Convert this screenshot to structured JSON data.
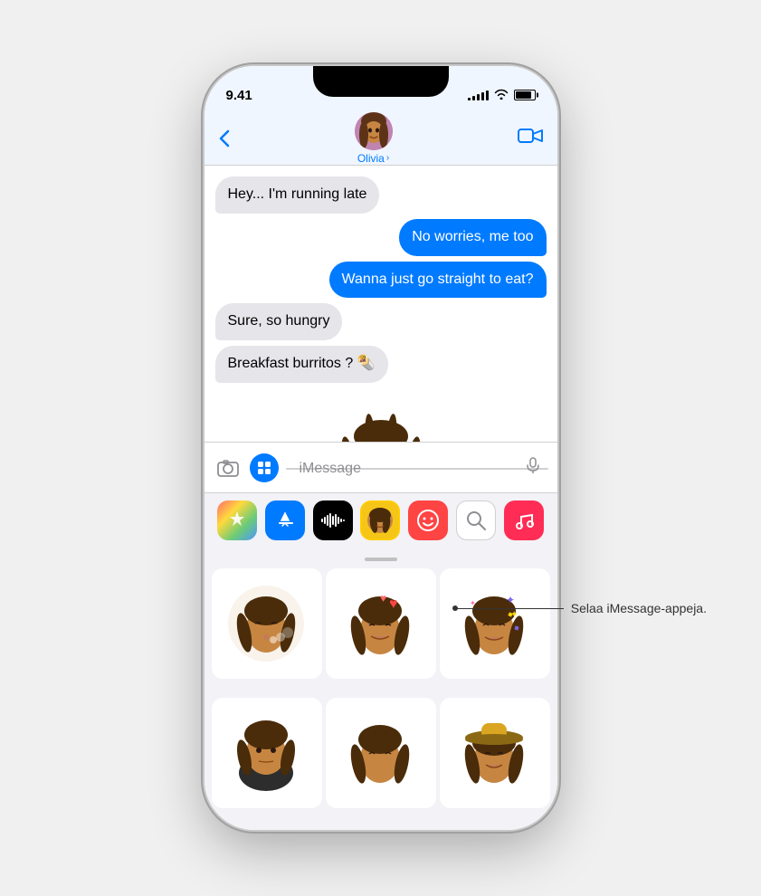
{
  "status_bar": {
    "time": "9.41",
    "signal_bars": [
      3,
      5,
      7,
      9,
      11
    ],
    "wifi": "wifi",
    "battery": 85
  },
  "nav": {
    "back_label": "‹",
    "contact_name": "Olivia",
    "chevron": "›",
    "video_icon": "video"
  },
  "messages": [
    {
      "id": 1,
      "type": "incoming",
      "text": "Hey... I'm running late"
    },
    {
      "id": 2,
      "type": "outgoing",
      "text": "No worries, me too"
    },
    {
      "id": 3,
      "type": "outgoing",
      "text": "Wanna just go straight to eat?"
    },
    {
      "id": 4,
      "type": "incoming",
      "text": "Sure, so hungry"
    },
    {
      "id": 5,
      "type": "incoming",
      "text": "Breakfast burritos ? 🌯"
    }
  ],
  "sticker_area": {
    "drag_handle": true,
    "stickers": [
      {
        "id": 1,
        "emoji": "😮‍💨",
        "label": "memoji-sneeze"
      },
      {
        "id": 2,
        "emoji": "🥰",
        "label": "memoji-love"
      },
      {
        "id": 3,
        "emoji": "🥳",
        "label": "memoji-party"
      },
      {
        "id": 4,
        "emoji": "😎",
        "label": "memoji-cool"
      },
      {
        "id": 5,
        "emoji": "🤭",
        "label": "memoji-shush"
      },
      {
        "id": 6,
        "emoji": "🤠",
        "label": "memoji-cowboy"
      }
    ]
  },
  "input_bar": {
    "camera_icon": "📷",
    "apps_label": "A",
    "placeholder": "iMessage",
    "mic_icon": "🎙"
  },
  "app_icons": [
    {
      "id": "photos",
      "label": "Photos",
      "icon": "🌈"
    },
    {
      "id": "appstore",
      "label": "App Store",
      "icon": "A"
    },
    {
      "id": "audio",
      "label": "Audio",
      "icon": "▶▶"
    },
    {
      "id": "memoji",
      "label": "Memoji",
      "icon": "😊",
      "active": true
    },
    {
      "id": "smileys",
      "label": "Smileys",
      "icon": "😂"
    },
    {
      "id": "search",
      "label": "Search",
      "icon": "🔍"
    },
    {
      "id": "music",
      "label": "Music",
      "icon": "♪"
    }
  ],
  "annotation": {
    "text": "Selaa iMessage-appeja."
  }
}
